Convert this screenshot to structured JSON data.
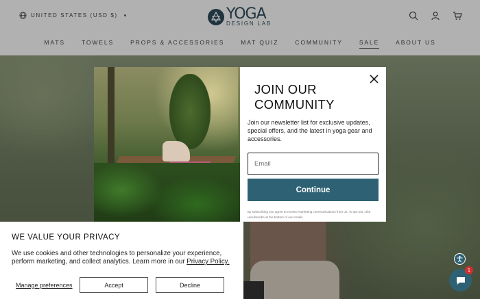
{
  "header": {
    "locale": "UNITED STATES (USD $)",
    "logo": {
      "big": "YOGA",
      "small": "DESIGN LAB"
    },
    "nav": [
      "MATS",
      "TOWELS",
      "PROPS & ACCESSORIES",
      "MAT QUIZ",
      "COMMUNITY",
      "SALE",
      "ABOUT US"
    ],
    "active_nav": "SALE"
  },
  "modal": {
    "title_line1": "JOIN OUR",
    "title_line2": "COMMUNITY",
    "description": "Join our newsletter list for exclusive updates, special offers, and the latest in yoga gear and accessories.",
    "email_placeholder": "Email",
    "continue_label": "Continue",
    "legal": "By subscribing you agree to receive marketing communications from us. To opt out, click unsubscribe at the bottom of our emails"
  },
  "cookie": {
    "title": "WE VALUE YOUR PRIVACY",
    "text": "We use cookies and other technologies to personalize your experience, perform marketing, and collect analytics. Learn more in our ",
    "policy_link": "Privacy Policy.",
    "manage_label": "Manage preferences",
    "accept_label": "Accept",
    "decline_label": "Decline"
  },
  "chat": {
    "badge": "1"
  },
  "colors": {
    "brand": "#2e6173",
    "badge": "#d03030"
  }
}
